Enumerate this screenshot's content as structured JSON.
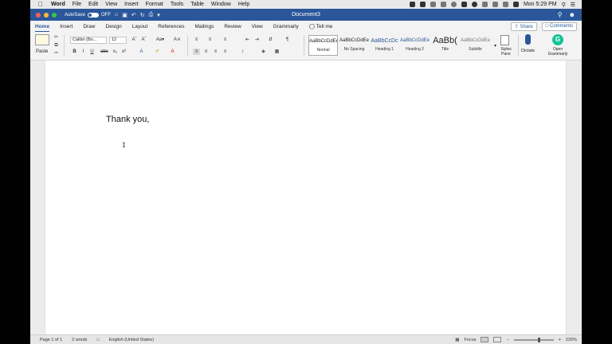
{
  "menubar": {
    "app": "Word",
    "items": [
      "File",
      "Edit",
      "View",
      "Insert",
      "Format",
      "Tools",
      "Table",
      "Window",
      "Help"
    ],
    "clock": "Mon 5:29 PM"
  },
  "titlebar": {
    "autosave_label": "AutoSave",
    "autosave_state": "OFF",
    "doc_title": "Document3"
  },
  "tabs": [
    "Home",
    "Insert",
    "Draw",
    "Design",
    "Layout",
    "References",
    "Mailings",
    "Review",
    "View",
    "Grammarly"
  ],
  "tell_me": "Tell me",
  "share_label": "Share",
  "comments_label": "Comments",
  "ribbon": {
    "paste_label": "Paste",
    "font_name": "Calibri (Bo...",
    "font_size": "12",
    "styles": [
      {
        "preview": "AaBbCcDdEe",
        "label": "Normal"
      },
      {
        "preview": "AaBbCcDdEe",
        "label": "No Spacing"
      },
      {
        "preview": "AaBbCcDc",
        "label": "Heading 1"
      },
      {
        "preview": "AaBbCcDdEe",
        "label": "Heading 2"
      },
      {
        "preview": "AaBb(",
        "label": "Title"
      },
      {
        "preview": "AaBbCcDdEe",
        "label": "Subtitle"
      }
    ],
    "styles_pane_label": "Styles Pane",
    "dictate_label": "Dictate",
    "grammarly_label": "Open Grammarly"
  },
  "document": {
    "line1": "Thank you,"
  },
  "statusbar": {
    "page": "Page 1 of 1",
    "words": "2 words",
    "language": "English (United States)",
    "focus": "Focus",
    "zoom": "220%"
  },
  "colors": {
    "word_blue": "#2b579a",
    "grammarly_green": "#15c39a"
  }
}
